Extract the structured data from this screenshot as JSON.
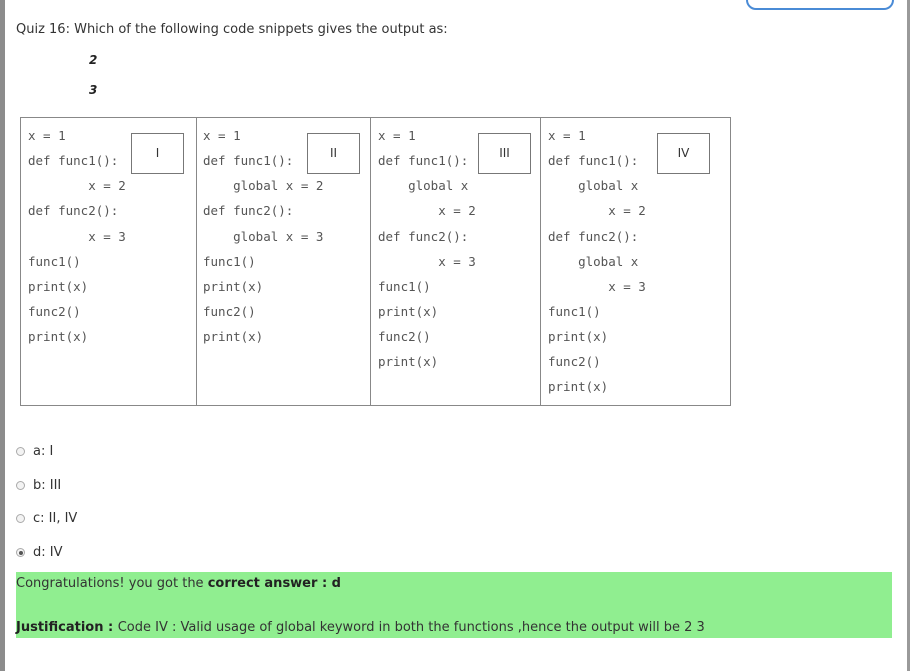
{
  "question": "Quiz 16: Which of the following code snippets gives the output as:",
  "expected_output": [
    "2",
    "3"
  ],
  "snippets": [
    {
      "label": "I",
      "lines": [
        "x = 1",
        "def func1():",
        "        x = 2",
        "def func2():",
        "        x = 3",
        "func1()",
        "print(x)",
        "func2()",
        "print(x)"
      ]
    },
    {
      "label": "II",
      "lines": [
        "x = 1",
        "def func1():",
        "    global x = 2",
        "def func2():",
        "    global x = 3",
        "func1()",
        "print(x)",
        "func2()",
        "print(x)"
      ]
    },
    {
      "label": "III",
      "lines": [
        "x = 1",
        "def func1():",
        "    global x",
        "        x = 2",
        "def func2():",
        "        x = 3",
        "func1()",
        "print(x)",
        "func2()",
        "print(x)"
      ]
    },
    {
      "label": "IV",
      "lines": [
        "x = 1",
        "def func1():",
        "    global x",
        "        x = 2",
        "def func2():",
        "    global x",
        "        x = 3",
        "func1()",
        "print(x)",
        "func2()",
        "print(x)"
      ]
    }
  ],
  "options": [
    {
      "text": "a: I",
      "selected": false
    },
    {
      "text": "b: III",
      "selected": false
    },
    {
      "text": "c: II, IV",
      "selected": false
    },
    {
      "text": "d: IV",
      "selected": true
    }
  ],
  "result": {
    "prefix": "Congratulations! you got the ",
    "bold": "correct answer : d",
    "justification_label": "Justification : ",
    "justification_text": "Code IV : Valid usage of global keyword in both the functions ,hence the output will be 2 3"
  },
  "colors": {
    "success_bg": "#90ee90",
    "border": "#888888"
  }
}
